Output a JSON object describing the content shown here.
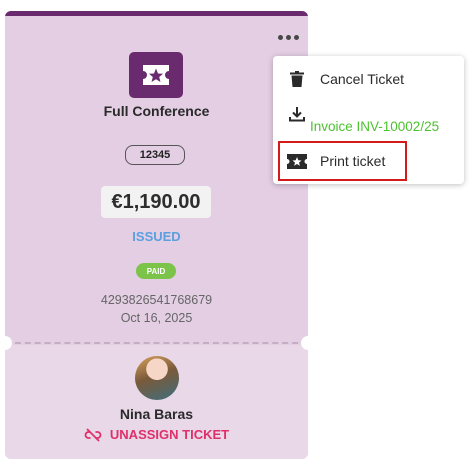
{
  "ticket": {
    "title": "Full Conference",
    "code": "12345",
    "price": "€1,190.00",
    "status": "ISSUED",
    "payment_badge": "PAID",
    "number": "4293826541768679",
    "date": "Oct 16, 2025",
    "attendee_name": "Nina Baras",
    "unassign_label": "UNASSIGN TICKET"
  },
  "menu": {
    "items": [
      {
        "label": "Cancel Ticket",
        "icon": "trash-icon"
      },
      {
        "label": "Invoice INV-10002/25",
        "icon": "download-icon"
      },
      {
        "label": "Print ticket",
        "icon": "ticket-icon"
      }
    ]
  },
  "colors": {
    "brand": "#6a2a6e",
    "card_bg": "#e3cee3",
    "status": "#5aa0e0",
    "paid": "#7cc349",
    "danger": "#e0306a",
    "invoice_link": "#4cc230",
    "highlight": "#d51a1a"
  }
}
